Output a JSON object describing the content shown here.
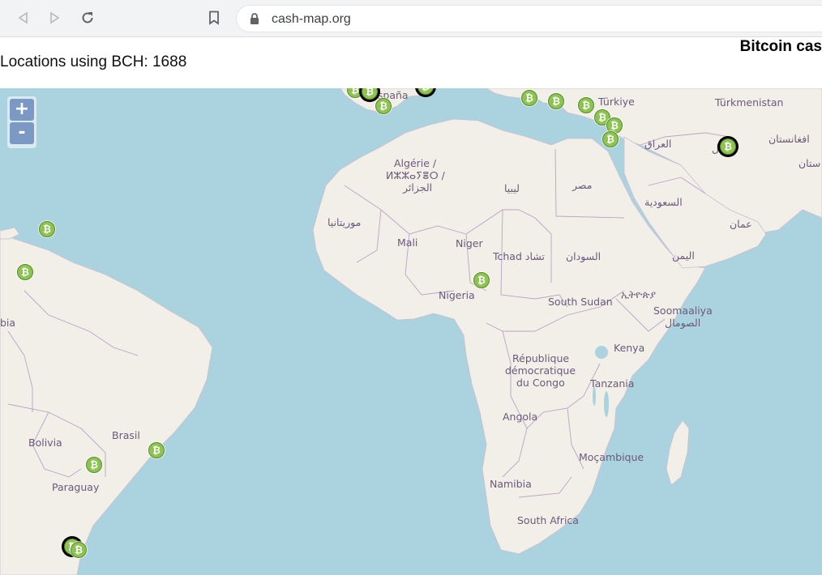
{
  "browser": {
    "url": "cash-map.org",
    "icons": [
      "back-icon",
      "forward-icon",
      "reload-icon",
      "bookmark-icon",
      "lock-icon"
    ]
  },
  "header": {
    "locations_text": "Locations using BCH: 1688",
    "site_title": "Bitcoin cas"
  },
  "map": {
    "colors": {
      "sea": "#aad3df",
      "land": "#f2efe9",
      "border": "#b9a3c7",
      "marker": "#8dc351"
    },
    "zoom": {
      "in_label": "+",
      "out_label": "-"
    },
    "labels": [
      {
        "name": "España"
      },
      {
        "name": "Türkiye"
      },
      {
        "name": "Türkmenistan"
      },
      {
        "name": "العراق"
      },
      {
        "name": "افغانستان"
      },
      {
        "name": "ستان"
      },
      {
        "name": "Algérie /"
      },
      {
        "name": "ⵍⵣⵣⴰⵢⴻⵔ /"
      },
      {
        "name": "الجزائر"
      },
      {
        "name": "ليبيا"
      },
      {
        "name": "مصر"
      },
      {
        "name": "السعودية"
      },
      {
        "name": "عمان"
      },
      {
        "name": "موريتانيا"
      },
      {
        "name": "Mali"
      },
      {
        "name": "Niger"
      },
      {
        "name": "Tchad تشاد"
      },
      {
        "name": "السودان"
      },
      {
        "name": "اليمن"
      },
      {
        "name": "Nigeria"
      },
      {
        "name": "South Sudan"
      },
      {
        "name": "ኢትዮጵያ"
      },
      {
        "name": "Soomaaliya"
      },
      {
        "name": "الصومال"
      },
      {
        "name": "bia"
      },
      {
        "name": "Kenya"
      },
      {
        "name": "République"
      },
      {
        "name": "démocratique"
      },
      {
        "name": "du Congo"
      },
      {
        "name": "Tanzania"
      },
      {
        "name": "Brasil"
      },
      {
        "name": "Bolivia"
      },
      {
        "name": "Angola"
      },
      {
        "name": "Moçambique"
      },
      {
        "name": "Paraguay"
      },
      {
        "name": "Namibia"
      },
      {
        "name": "South Africa"
      },
      {
        "name": "ل"
      }
    ]
  }
}
